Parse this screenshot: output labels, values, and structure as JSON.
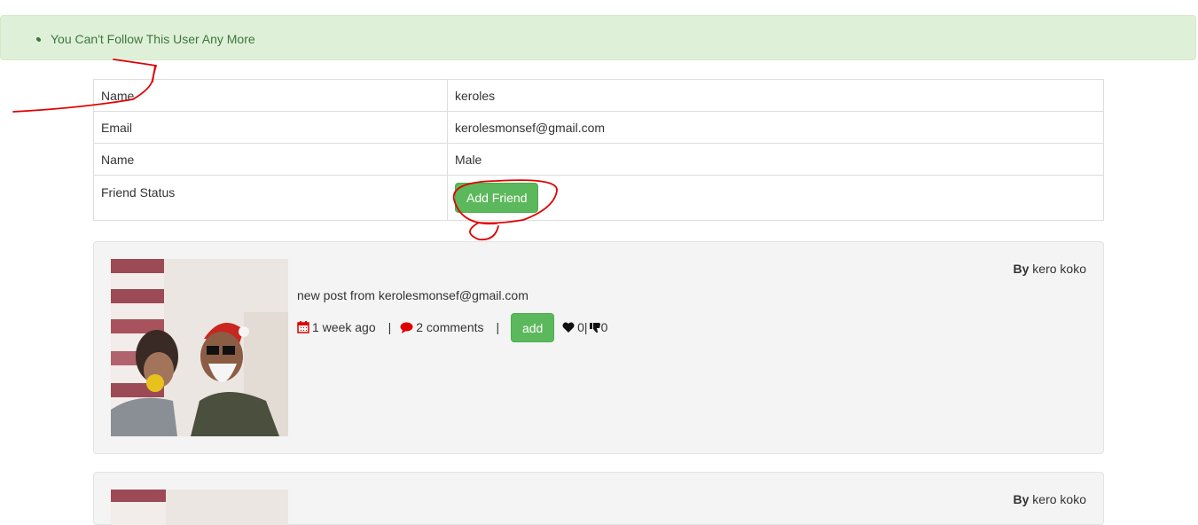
{
  "alert": {
    "message": "You Can't Follow This User Any More"
  },
  "profile": {
    "rows": [
      {
        "label": "Name",
        "value": "keroles"
      },
      {
        "label": "Email",
        "value": "kerolesmonsef@gmail.com"
      },
      {
        "label": "Name",
        "value": "Male"
      }
    ],
    "status_label": "Friend Status",
    "add_friend_label": "Add Friend"
  },
  "posts": [
    {
      "by_label": "By",
      "author": "kero koko",
      "body": "new post from kerolesmonsef@gmail.com",
      "time": "1 week ago",
      "comments": "2 comments",
      "add_label": "add",
      "likes": "0|",
      "dislikes": "0"
    },
    {
      "by_label": "By",
      "author": "kero koko"
    }
  ],
  "colors": {
    "success": "#5cb85c",
    "alert_bg": "#dff0d8",
    "icon_red": "#dd0000",
    "annotation": "#e00000"
  },
  "icons": [
    "calendar-icon",
    "comment-icon",
    "heart-icon",
    "thumbs-down-icon"
  ]
}
